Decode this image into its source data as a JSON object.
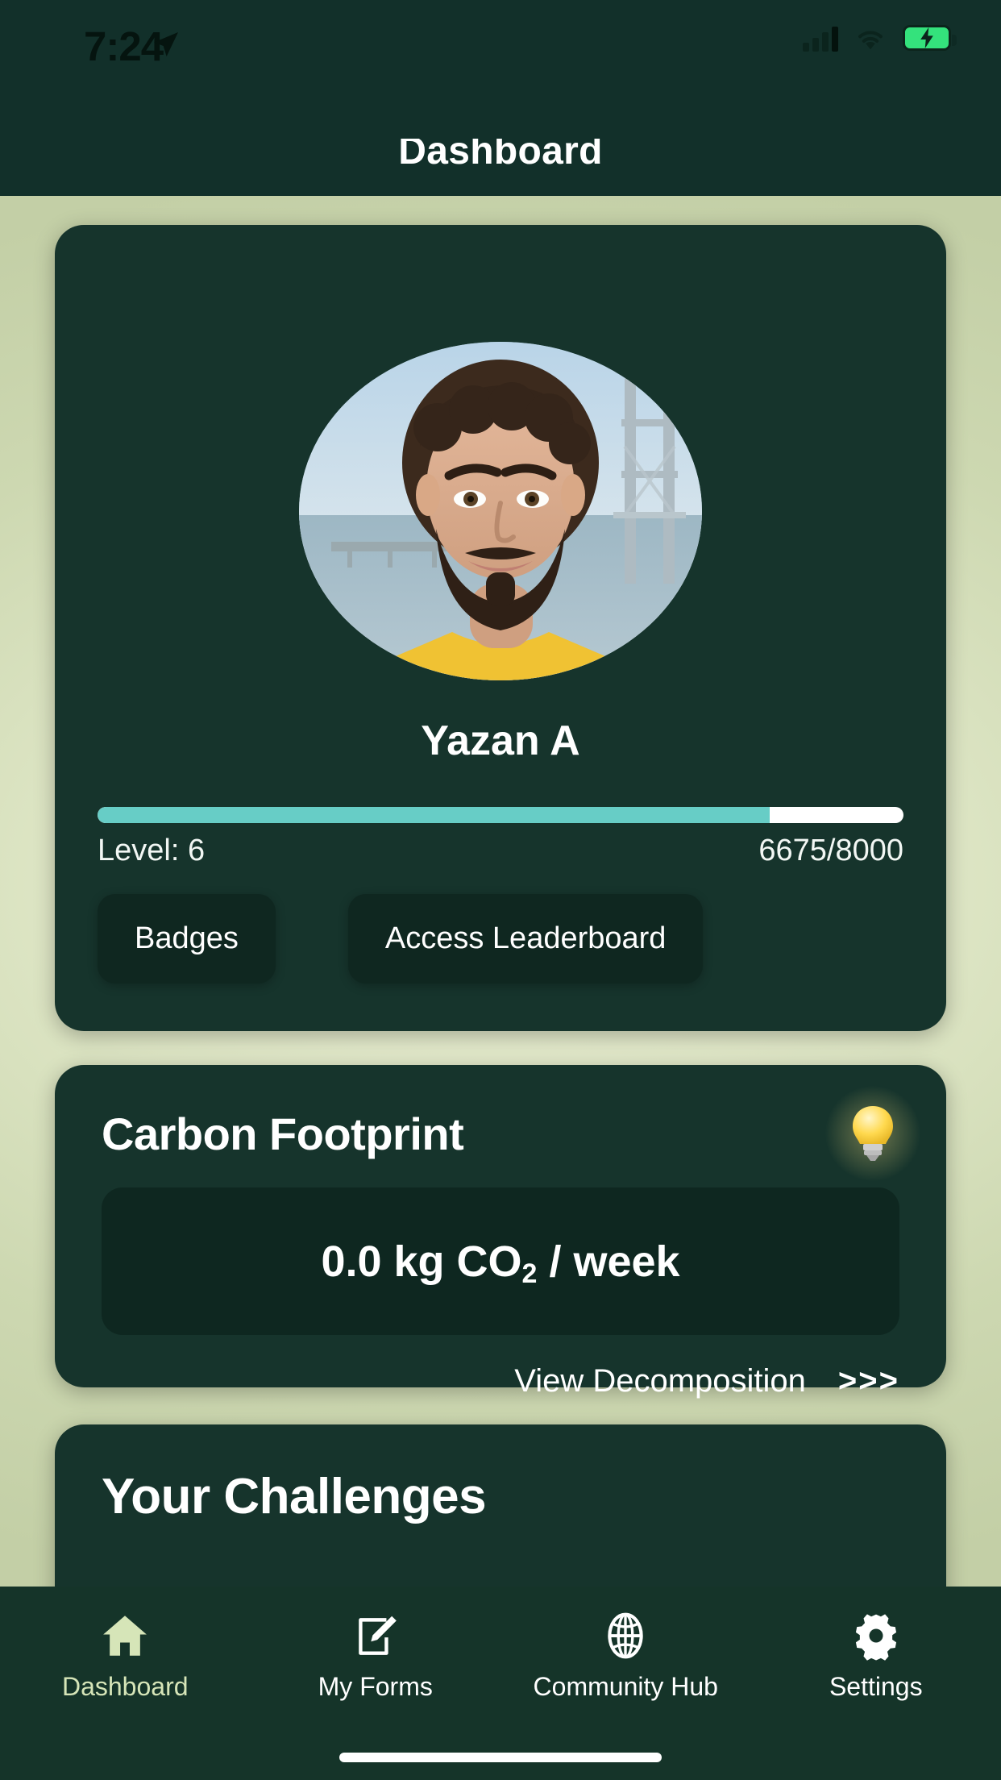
{
  "status_bar": {
    "time": "7:24",
    "location_icon": "location-arrow-icon",
    "signal_icon": "cellular-signal-icon",
    "wifi_icon": "wifi-icon",
    "battery_icon": "battery-charging-icon",
    "battery_color": "#34e27c"
  },
  "header": {
    "title": "Dashboard"
  },
  "profile": {
    "avatar_alt": "user-profile-photo",
    "name": "Yazan A",
    "level_label": "Level: 6",
    "xp_label": "6675/8000",
    "xp_current": 6675,
    "xp_max": 8000,
    "progress_percent": 83.4,
    "progress_color": "#67cdc6",
    "badges_button": "Badges",
    "leaderboard_button": "Access Leaderboard"
  },
  "carbon": {
    "title": "Carbon Footprint",
    "tip_icon": "lightbulb-icon",
    "value": "0.0 kg CO",
    "value_sub": "2",
    "value_suffix": " / week",
    "link_text": "View Decomposition",
    "link_arrow": ">>>"
  },
  "challenges": {
    "title": "Your Challenges"
  },
  "tabbar": {
    "items": [
      {
        "label": "Dashboard",
        "icon": "home-icon",
        "active": true
      },
      {
        "label": "My Forms",
        "icon": "form-edit-icon",
        "active": false
      },
      {
        "label": "Community Hub",
        "icon": "globe-icon",
        "active": false
      },
      {
        "label": "Settings",
        "icon": "gear-icon",
        "active": false
      }
    ]
  },
  "theme": {
    "card_bg": "#16342c",
    "header_bg": "#12302a",
    "accent": "#67cdc6",
    "active_tab": "#d6e5b8"
  }
}
